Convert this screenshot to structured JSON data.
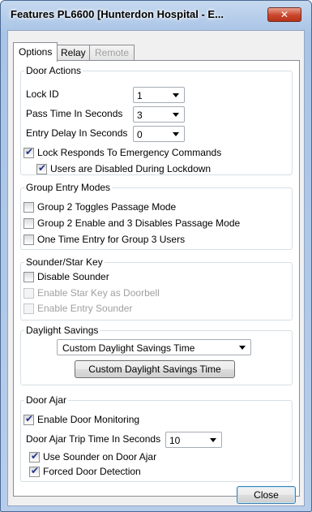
{
  "window": {
    "title": "Features PL6600 [Hunterdon Hospital - E...",
    "close_glyph": "✕"
  },
  "tabs": [
    {
      "label": "Options",
      "state": "active"
    },
    {
      "label": "Relay",
      "state": "normal"
    },
    {
      "label": "Remote",
      "state": "disabled"
    }
  ],
  "door_actions": {
    "heading": "Door Actions",
    "lock_id_label": "Lock ID",
    "lock_id_value": "1",
    "pass_time_label": "Pass Time  In Seconds",
    "pass_time_value": "3",
    "entry_delay_label": "Entry Delay In Seconds",
    "entry_delay_value": "0",
    "emergency_label": "Lock Responds To Emergency Commands",
    "emergency_checked": true,
    "lockdown_label": "Users are Disabled During Lockdown",
    "lockdown_checked": true
  },
  "group_entry": {
    "heading": "Group Entry Modes",
    "toggles_label": "Group 2 Toggles Passage Mode",
    "enable_disable_label": "Group 2 Enable and 3 Disables Passage Mode",
    "one_time_label": "One Time Entry for Group 3 Users"
  },
  "sounder": {
    "heading": "Sounder/Star Key",
    "disable_sounder_label": "Disable Sounder",
    "star_doorbell_label": "Enable Star Key as Doorbell",
    "entry_sounder_label": "Enable Entry Sounder"
  },
  "daylight": {
    "heading": "Daylight Savings",
    "select_value": "Custom Daylight Savings Time",
    "button_label": "Custom Daylight Savings Time"
  },
  "door_ajar": {
    "heading": "Door Ajar",
    "monitoring_label": "Enable Door Monitoring",
    "monitoring_checked": true,
    "trip_time_label": "Door Ajar Trip Time In Seconds",
    "trip_time_value": "10",
    "sounder_label": "Use Sounder on Door Ajar",
    "sounder_checked": true,
    "forced_label": "Forced Door Detection",
    "forced_checked": true
  },
  "footer": {
    "close_label": "Close"
  },
  "colors": {
    "window_frame": "#b7cde9",
    "close_button": "#c9462c",
    "check_mark": "#21338a",
    "disabled_text": "#a0a0a0"
  }
}
